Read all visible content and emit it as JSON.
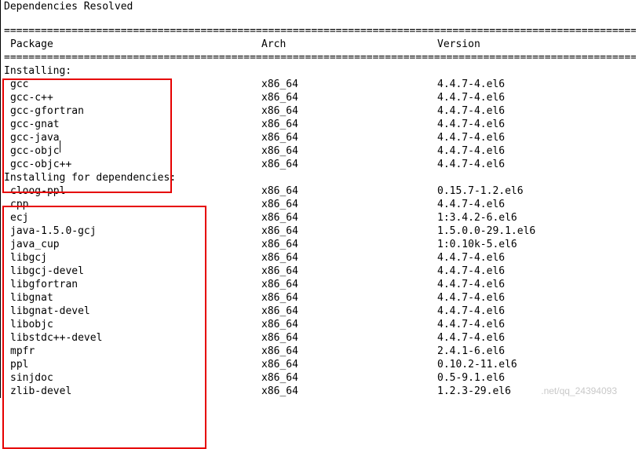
{
  "title": "Dependencies Resolved",
  "divider": "================================================================================================================",
  "columns": {
    "package": "Package",
    "arch": "Arch",
    "version": "Version"
  },
  "sections": {
    "installing": {
      "label": "Installing:"
    },
    "installing_deps": {
      "label": "Installing for dependencies:"
    }
  },
  "installing": [
    {
      "package": "gcc",
      "arch": "x86_64",
      "version": "4.4.7-4.el6"
    },
    {
      "package": "gcc-c++",
      "arch": "x86_64",
      "version": "4.4.7-4.el6"
    },
    {
      "package": "gcc-gfortran",
      "arch": "x86_64",
      "version": "4.4.7-4.el6"
    },
    {
      "package": "gcc-gnat",
      "arch": "x86_64",
      "version": "4.4.7-4.el6"
    },
    {
      "package": "gcc-java",
      "arch": "x86_64",
      "version": "4.4.7-4.el6",
      "cursor": true
    },
    {
      "package": "gcc-objc",
      "arch": "x86_64",
      "version": "4.4.7-4.el6"
    },
    {
      "package": "gcc-objc++",
      "arch": "x86_64",
      "version": "4.4.7-4.el6"
    }
  ],
  "dependencies": [
    {
      "package": "cloog-ppl",
      "arch": "x86_64",
      "version": "0.15.7-1.2.el6"
    },
    {
      "package": "cpp",
      "arch": "x86_64",
      "version": "4.4.7-4.el6"
    },
    {
      "package": "ecj",
      "arch": "x86_64",
      "version": "1:3.4.2-6.el6"
    },
    {
      "package": "java-1.5.0-gcj",
      "arch": "x86_64",
      "version": "1.5.0.0-29.1.el6"
    },
    {
      "package": "java_cup",
      "arch": "x86_64",
      "version": "1:0.10k-5.el6"
    },
    {
      "package": "libgcj",
      "arch": "x86_64",
      "version": "4.4.7-4.el6"
    },
    {
      "package": "libgcj-devel",
      "arch": "x86_64",
      "version": "4.4.7-4.el6"
    },
    {
      "package": "libgfortran",
      "arch": "x86_64",
      "version": "4.4.7-4.el6"
    },
    {
      "package": "libgnat",
      "arch": "x86_64",
      "version": "4.4.7-4.el6"
    },
    {
      "package": "libgnat-devel",
      "arch": "x86_64",
      "version": "4.4.7-4.el6"
    },
    {
      "package": "libobjc",
      "arch": "x86_64",
      "version": "4.4.7-4.el6"
    },
    {
      "package": "libstdc++-devel",
      "arch": "x86_64",
      "version": "4.4.7-4.el6"
    },
    {
      "package": "mpfr",
      "arch": "x86_64",
      "version": "2.4.1-6.el6"
    },
    {
      "package": "ppl",
      "arch": "x86_64",
      "version": "0.10.2-11.el6"
    },
    {
      "package": "sinjdoc",
      "arch": "x86_64",
      "version": "0.5-9.1.el6"
    },
    {
      "package": "zlib-devel",
      "arch": "x86_64",
      "version": "1.2.3-29.el6"
    }
  ],
  "watermark": ".net/qq_24394093"
}
